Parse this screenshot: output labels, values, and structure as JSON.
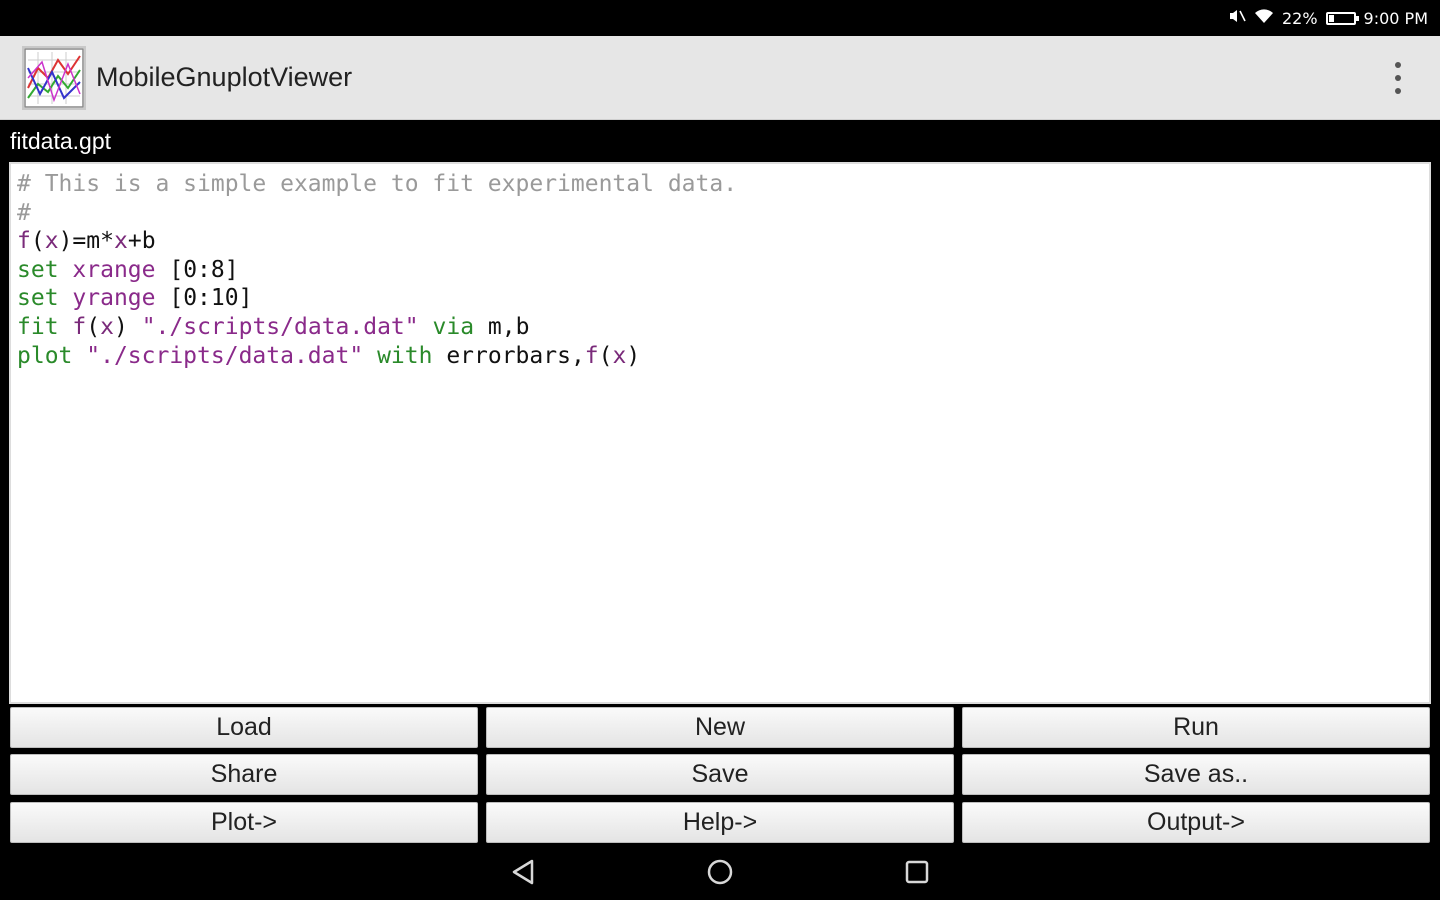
{
  "status_bar": {
    "battery": "22%",
    "battery_level": 0.22,
    "time": "9:00 PM",
    "icons": [
      "mute-icon",
      "wifi-icon",
      "battery-icon"
    ]
  },
  "app_bar": {
    "title": "MobileGnuplotViewer",
    "logo_icon": "gnuplot-logo-icon",
    "menu_icon": "overflow-menu-icon"
  },
  "file": {
    "name": "fitdata.gpt"
  },
  "editor": {
    "lines": [
      "# This is a simple example to fit experimental data.",
      "#",
      "f(x)=m*x+b",
      "set xrange [0:8]",
      "set yrange [0:10]",
      "fit f(x) \"./scripts/data.dat\" via m,b",
      "plot \"./scripts/data.dat\" with errorbars,f(x)"
    ],
    "colors": {
      "comment": "#9a9a9a",
      "keyword": "#2a8a2a",
      "string": "#8a2a8a"
    }
  },
  "buttons": {
    "load": "Load",
    "new": "New",
    "run": "Run",
    "share": "Share",
    "save": "Save",
    "save_as": "Save as..",
    "plot": "Plot->",
    "help": "Help->",
    "output": "Output->"
  },
  "nav_bar": {
    "icons": [
      "back-icon",
      "home-icon",
      "recents-icon"
    ]
  }
}
